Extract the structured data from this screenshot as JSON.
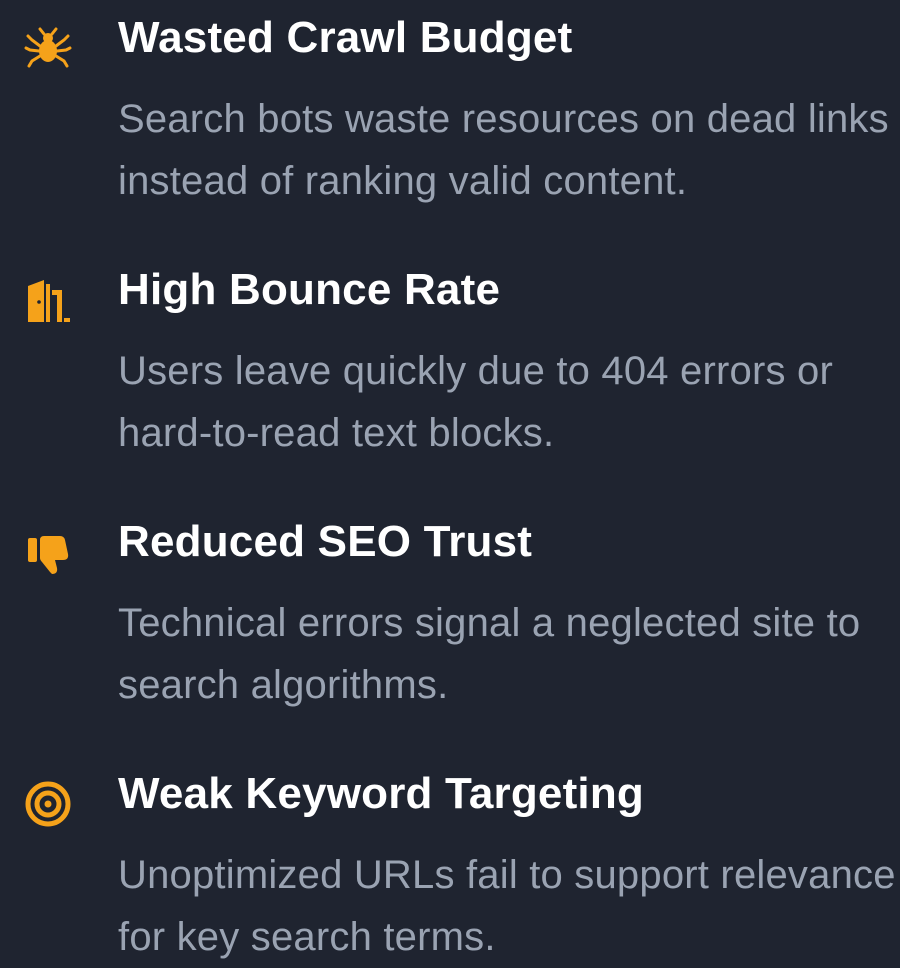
{
  "accent_color": "#f5a21a",
  "background_color": "#1f2430",
  "items": [
    {
      "icon": "spider-icon",
      "title": "Wasted Crawl Budget",
      "description": "Search bots waste resources on dead links instead of ranking valid content."
    },
    {
      "icon": "door-exit-icon",
      "title": "High Bounce Rate",
      "description": "Users leave quickly due to 404 errors or hard-to-read text blocks."
    },
    {
      "icon": "thumbs-down-icon",
      "title": "Reduced SEO Trust",
      "description": "Technical errors signal a neglected site to search algorithms."
    },
    {
      "icon": "target-icon",
      "title": "Weak Keyword Targeting",
      "description": "Unoptimized URLs fail to support relevance for key search terms."
    }
  ]
}
